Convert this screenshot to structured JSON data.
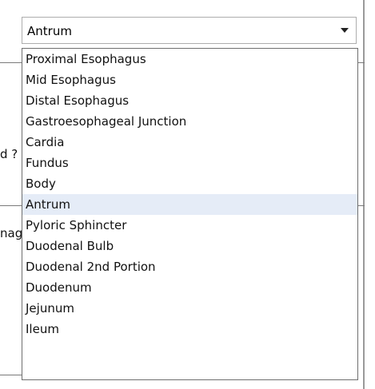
{
  "combo": {
    "selected_value": "Antrum",
    "arrow_icon": "chevron-down-icon"
  },
  "dropdown": {
    "items": [
      "Proximal Esophagus",
      "Mid Esophagus",
      "Distal Esophagus",
      "Gastroesophageal Junction",
      "Cardia",
      "Fundus",
      "Body",
      "Antrum",
      "Pyloric Sphincter",
      "Duodenal Bulb",
      "Duodenal 2nd Portion",
      "Duodenum",
      "Jejunum",
      "Ileum"
    ],
    "selected_index": 7
  },
  "background": {
    "fragment_1": "d ?",
    "fragment_2": "nag"
  }
}
